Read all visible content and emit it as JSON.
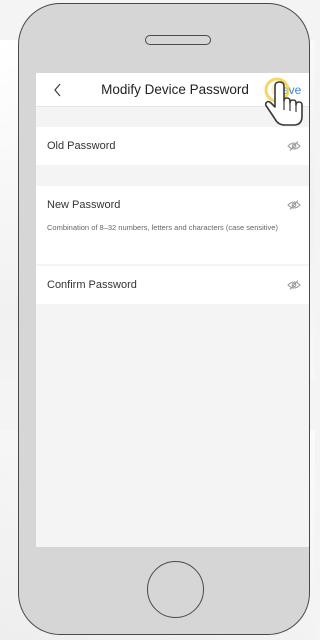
{
  "header": {
    "title": "Modify Device Password",
    "save_label": "Save"
  },
  "form": {
    "old_password_label": "Old Password",
    "new_password_label": "New Password",
    "new_password_hint": "Combination of 8–32 numbers, letters and characters (case sensitive)",
    "confirm_password_label": "Confirm Password"
  },
  "icons": {
    "back": "chevron-left-icon",
    "visibility": "eye-off-icon",
    "cursor": "hand-pointer-icon"
  },
  "colors": {
    "accent": "#3b7dd8",
    "highlight": "#f2d04a"
  }
}
